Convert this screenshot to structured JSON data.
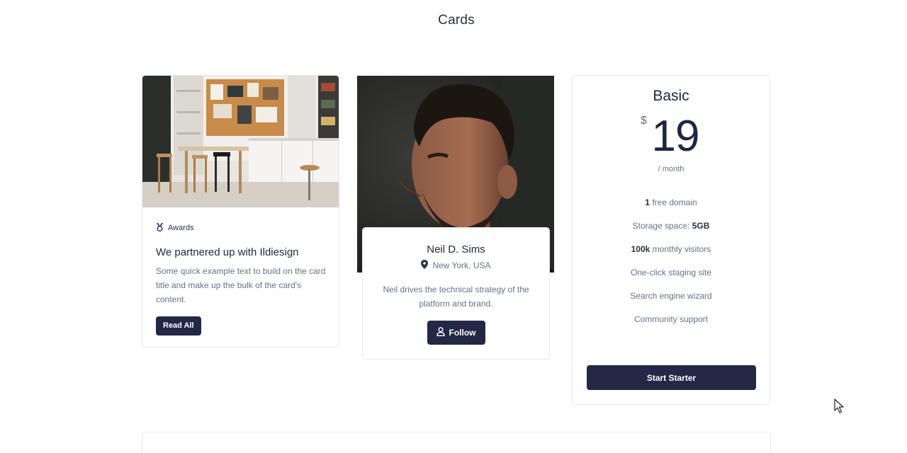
{
  "page": {
    "title": "Cards"
  },
  "blog_card": {
    "badge": "Awards",
    "title": "We partnered up with Ildiesign",
    "text": "Some quick example text to build on the card title and make up the bulk of the card's content.",
    "button": "Read All"
  },
  "profile_card": {
    "name": "Neil D. Sims",
    "location": "New York, USA",
    "text": "Neil drives the technical strategy of the platform and brand.",
    "button": "Follow"
  },
  "pricing_card": {
    "plan": "Basic",
    "currency": "$",
    "price": "19",
    "period": "/ month",
    "features": [
      {
        "bold": "1",
        "rest": " free domain"
      },
      {
        "bold": "",
        "rest": "Storage space: ",
        "bold_after": "5GB"
      },
      {
        "bold": "100k",
        "rest": " monthly visitors"
      },
      {
        "bold": "",
        "rest": "One-click staging site"
      },
      {
        "bold": "",
        "rest": "Search engine wizard"
      },
      {
        "bold": "",
        "rest": "Community support"
      }
    ],
    "button": "Start Starter"
  },
  "colors": {
    "primary": "#222845",
    "text": "#1f2544",
    "muted": "#6a7086",
    "border": "#e6e8ee"
  },
  "icons": {
    "badge": "medal-icon",
    "location": "map-pin-icon",
    "follow": "user-icon",
    "cursor": "mouse-cursor-icon"
  }
}
